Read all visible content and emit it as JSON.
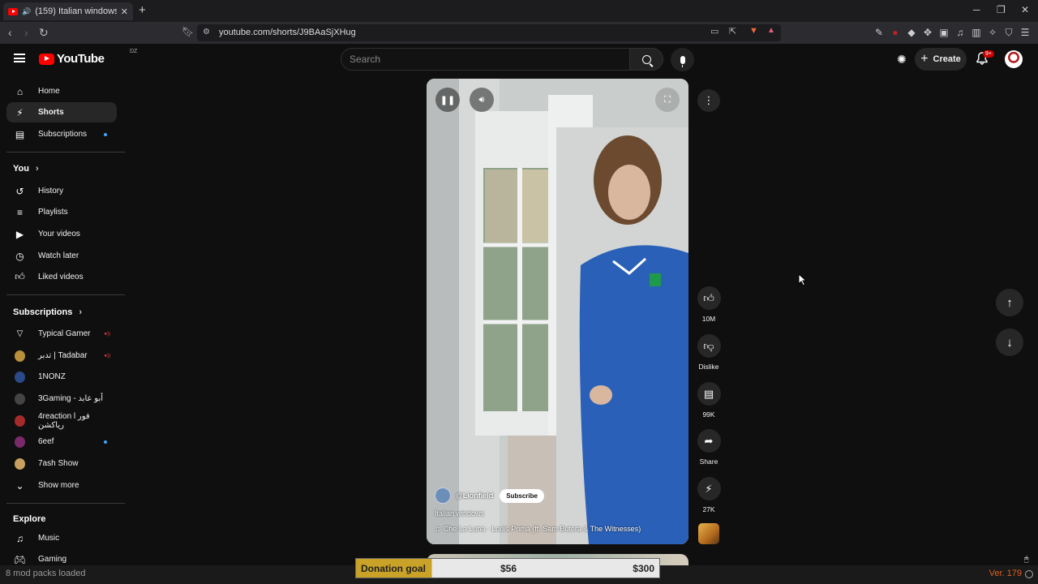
{
  "browser": {
    "tab_title": "(159) Italian windows - YouTube",
    "url": "youtube.com/shorts/J9BAaSjXHug",
    "new_tab": "+",
    "win_min": "─",
    "win_max": "❐",
    "win_close": "✕"
  },
  "masthead": {
    "logo_text": "YouTube",
    "country_code": "DZ",
    "search_placeholder": "Search",
    "create_label": "Create",
    "notif_badge": "9+"
  },
  "sidebar": {
    "main": [
      {
        "label": "Home",
        "icon": "home-icon"
      },
      {
        "label": "Shorts",
        "icon": "shorts-icon"
      },
      {
        "label": "Subscriptions",
        "icon": "subscriptions-icon"
      }
    ],
    "you_header": "You",
    "you_items": [
      {
        "label": "History",
        "icon": "history-icon"
      },
      {
        "label": "Playlists",
        "icon": "playlists-icon"
      },
      {
        "label": "Your videos",
        "icon": "your-videos-icon"
      },
      {
        "label": "Watch later",
        "icon": "watch-later-icon"
      },
      {
        "label": "Liked videos",
        "icon": "liked-videos-icon"
      }
    ],
    "subs_header": "Subscriptions",
    "subs": [
      {
        "label": "Typical Gamer",
        "color": "#1a1a1a"
      },
      {
        "label": "تدبر | Tadabar",
        "color": "#b8913a"
      },
      {
        "label": "1NONZ",
        "color": "#2a4a8a"
      },
      {
        "label": "3Gaming - أبو عابد",
        "color": "#444444"
      },
      {
        "label": "4reaction l فور رياكشن",
        "color": "#a52a2a"
      },
      {
        "label": "6eef",
        "color": "#7a2a6a"
      },
      {
        "label": "7ash Show",
        "color": "#c8a060"
      }
    ],
    "show_more": "Show more",
    "explore_header": "Explore",
    "explore": [
      {
        "label": "Music",
        "icon": "music-icon"
      },
      {
        "label": "Gaming",
        "icon": "gaming-icon"
      }
    ]
  },
  "short": {
    "channel": "@Lionfield",
    "subscribe": "Subscribe",
    "title": "Italian windows",
    "music": "Che La Luna · Louis Prima (ft. Sam Butera & The Witnesses)",
    "likes": "10M",
    "dislike": "Dislike",
    "comments": "99K",
    "share": "Share",
    "remix": "27K"
  },
  "overlay": {
    "mods_loaded": "8 mod packs loaded",
    "version": "Ver. 179",
    "donation_label": "Donation goal",
    "donation_current": "$56",
    "donation_target": "$300",
    "donation_progress": 0.19
  }
}
